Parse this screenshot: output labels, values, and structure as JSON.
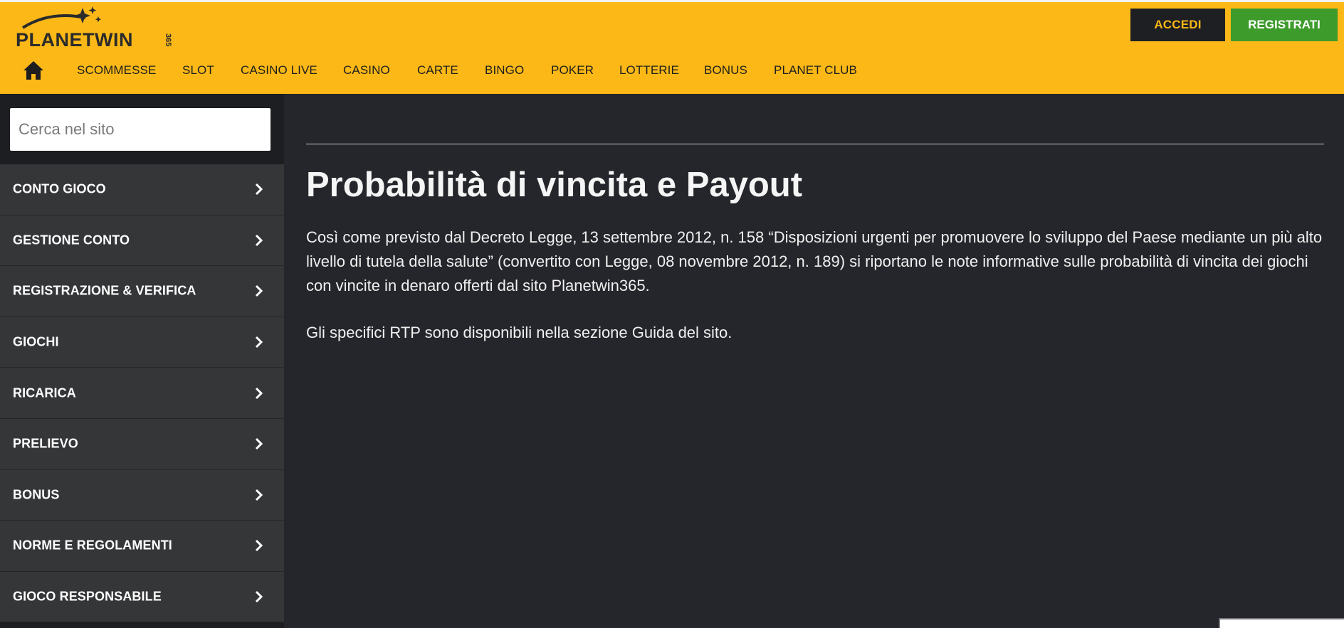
{
  "header": {
    "logo_text": "PLANETWIN",
    "logo_suffix": "365",
    "accedi_label": "ACCEDI",
    "registrati_label": "REGISTRATI"
  },
  "nav": {
    "home_icon": "home-icon",
    "items": [
      {
        "label": "SCOMMESSE"
      },
      {
        "label": "SLOT"
      },
      {
        "label": "CASINO LIVE"
      },
      {
        "label": "CASINO"
      },
      {
        "label": "CARTE"
      },
      {
        "label": "BINGO"
      },
      {
        "label": "POKER"
      },
      {
        "label": "LOTTERIE"
      },
      {
        "label": "BONUS"
      },
      {
        "label": "PLANET CLUB"
      }
    ]
  },
  "sidebar": {
    "search_placeholder": "Cerca nel sito",
    "items": [
      {
        "label": "CONTO GIOCO"
      },
      {
        "label": "GESTIONE CONTO"
      },
      {
        "label": "REGISTRAZIONE & VERIFICA"
      },
      {
        "label": "GIOCHI"
      },
      {
        "label": "RICARICA"
      },
      {
        "label": "PRELIEVO"
      },
      {
        "label": "BONUS"
      },
      {
        "label": "NORME E REGOLAMENTI"
      },
      {
        "label": "GIOCO RESPONSABILE"
      }
    ]
  },
  "main": {
    "title": "Probabilità di vincita e Payout",
    "paragraph1": "Così come previsto dal Decreto Legge, 13 settembre 2012, n. 158 “Disposizioni urgenti per promuovere lo sviluppo del Paese mediante un più alto livello di tutela della salute” (convertito con Legge, 08 novembre 2012, n. 189) si riportano le note informative sulle probabilità di vincita dei giochi con vincite in denaro offerti dal sito Planetwin365.",
    "paragraph2": "Gli specifici RTP sono disponibili nella sezione Guida del sito."
  },
  "colors": {
    "brand_yellow": "#fbb817",
    "register_green": "#3d9b2c",
    "dark_bg": "#24262b",
    "sidebar_item_bg": "#353638"
  }
}
